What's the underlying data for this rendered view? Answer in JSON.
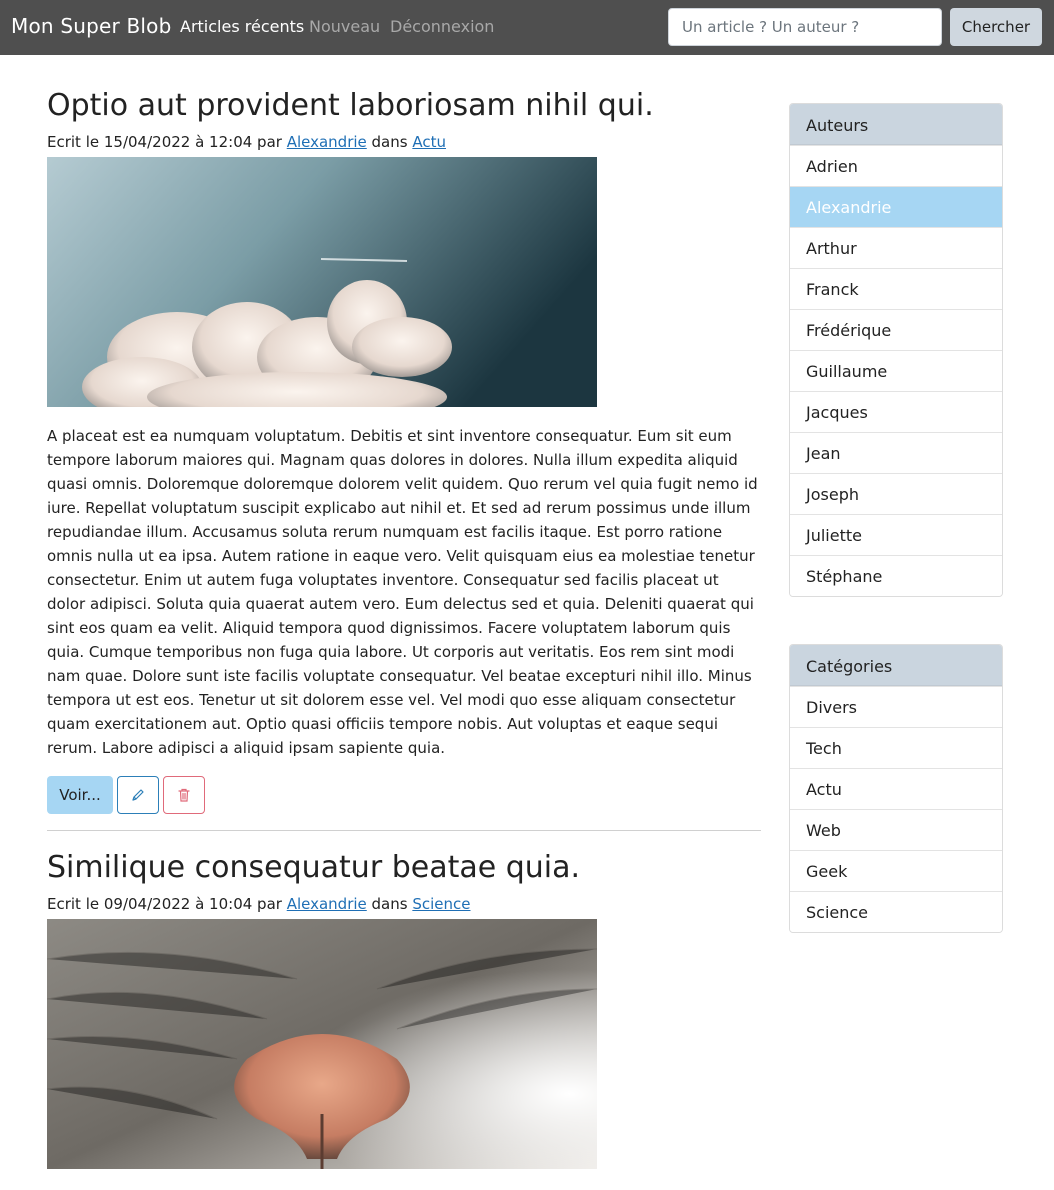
{
  "navbar": {
    "brand": "Mon Super Blob",
    "links": [
      {
        "label": "Articles récents",
        "active": true
      },
      {
        "label": "Nouveau",
        "active": false
      },
      {
        "label": "Déconnexion",
        "active": false
      }
    ],
    "search": {
      "placeholder": "Un article ? Un auteur ?",
      "value": "",
      "button_label": "Chercher"
    }
  },
  "articles": [
    {
      "title": "Optio aut provident laboriosam nihil qui.",
      "meta_prefix": "Ecrit le 15/04/2022 à 12:04 par ",
      "author": "Alexandrie",
      "meta_mid": " dans ",
      "category": "Actu",
      "image": "sky-clouds-photo",
      "body": "A placeat est ea numquam voluptatum. Debitis et sint inventore consequatur. Eum sit eum tempore laborum maiores qui. Magnam quas dolores in dolores. Nulla illum expedita aliquid quasi omnis. Doloremque doloremque dolorem velit quidem. Quo rerum vel quia fugit nemo id iure. Repellat voluptatum suscipit explicabo aut nihil et. Et sed ad rerum possimus unde illum repudiandae illum. Accusamus soluta rerum numquam est facilis itaque. Est porro ratione omnis nulla ut ea ipsa. Autem ratione in eaque vero. Velit quisquam eius ea molestiae tenetur consectetur. Enim ut autem fuga voluptates inventore. Consequatur sed facilis placeat ut dolor adipisci. Soluta quia quaerat autem vero. Eum delectus sed et quia. Deleniti quaerat qui sint eos quam ea velit. Aliquid tempora quod dignissimos. Facere voluptatem laborum quis quia. Cumque temporibus non fuga quia labore. Ut corporis aut veritatis. Eos rem sint modi nam quae. Dolore sunt iste facilis voluptate consequatur. Vel beatae excepturi nihil illo. Minus tempora ut est eos. Tenetur ut sit dolorem esse vel. Vel modi quo esse aliquam consectetur quam exercitationem aut. Optio quasi officiis tempore nobis. Aut voluptas et eaque sequi rerum. Labore adipisci a aliquid ipsam sapiente quia.",
      "voir_label": "Voir...",
      "edit_icon": "pencil-icon",
      "delete_icon": "trash-icon"
    },
    {
      "title": "Similique consequatur beatae quia.",
      "meta_prefix": "Ecrit le 09/04/2022 à 10:04 par ",
      "author": "Alexandrie",
      "meta_mid": " dans ",
      "category": "Science",
      "image": "cat-nose-photo"
    }
  ],
  "sidebar": {
    "authors": {
      "header": "Auteurs",
      "items": [
        "Adrien",
        "Alexandrie",
        "Arthur",
        "Franck",
        "Frédérique",
        "Guillaume",
        "Jacques",
        "Jean",
        "Joseph",
        "Juliette",
        "Stéphane"
      ],
      "active": "Alexandrie"
    },
    "categories": {
      "header": "Catégories",
      "items": [
        "Divers",
        "Tech",
        "Actu",
        "Web",
        "Geek",
        "Science"
      ]
    }
  },
  "colors": {
    "navbar_bg": "#4f4f4f",
    "accent_light_blue": "#a6d6f3",
    "panel_header_bg": "#cad5df",
    "link_blue": "#1f6fb5",
    "delete_red": "#e06a7a"
  }
}
